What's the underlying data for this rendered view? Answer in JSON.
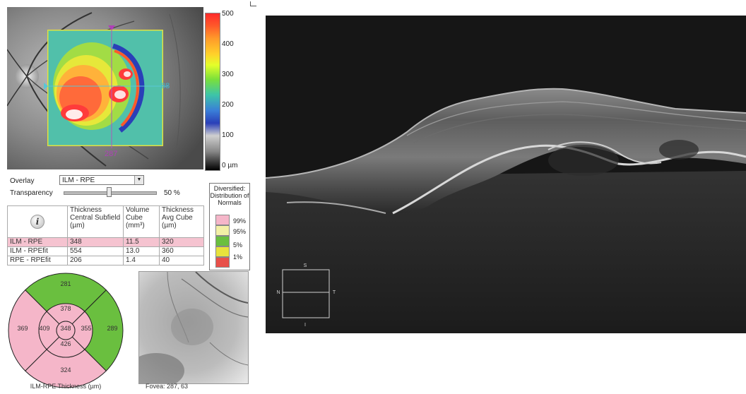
{
  "thickness_map": {
    "horizontal_marker": "88",
    "vertical_marker": "287"
  },
  "colorbar": {
    "ticks": [
      "500",
      "400",
      "300",
      "200",
      "100",
      "0 µm"
    ]
  },
  "overlay": {
    "label": "Overlay",
    "selected": "ILM - RPE",
    "transparency_label": "Transparency",
    "transparency_value": "50 %",
    "transparency_level": 0.5
  },
  "table": {
    "headers": [
      "Thickness Central Subfield (µm)",
      "Volume Cube (mm³)",
      "Thickness Avg Cube (µm)"
    ],
    "rows": [
      {
        "name": "ILM - RPE",
        "central": "348",
        "volume": "11.5",
        "avg": "320"
      },
      {
        "name": "ILM - RPEfit",
        "central": "554",
        "volume": "13.0",
        "avg": "360"
      },
      {
        "name": "RPE - RPEfit",
        "central": "206",
        "volume": "1.4",
        "avg": "40"
      }
    ]
  },
  "normals": {
    "title": "Diversified: Distribution of Normals",
    "levels": [
      {
        "label": "99%",
        "color": "#f5b6c9"
      },
      {
        "label": "95%",
        "color": "#f3f0a6"
      },
      {
        "label": "5%",
        "color": "#6abf3f"
      },
      {
        "label": "1%",
        "color": "#e8e23c"
      },
      {
        "label": "",
        "color": "#e8504a"
      }
    ]
  },
  "etdrs": {
    "caption": "ILM-RPE Thickness (µm)",
    "outer_superior": "281",
    "outer_inferior": "324",
    "outer_nasal": "369",
    "outer_temporal": "289",
    "inner_superior": "378",
    "inner_inferior": "426",
    "inner_nasal": "409",
    "inner_temporal": "355",
    "center": "348",
    "pink": "#f5b6c9",
    "green": "#6abf3f"
  },
  "enface": {
    "caption": "Fovea: 287, 63"
  },
  "bscan": {
    "orientation": {
      "top": "S",
      "bottom": "I",
      "left": "N",
      "right": "T"
    }
  }
}
